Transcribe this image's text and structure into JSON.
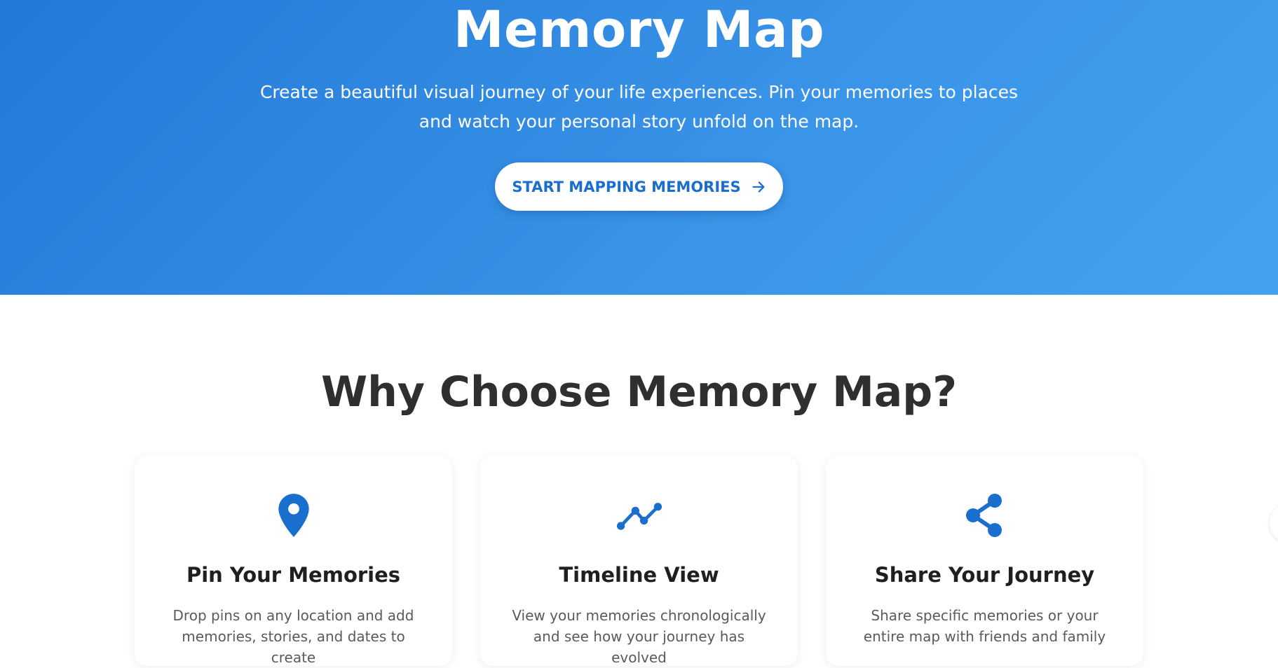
{
  "hero": {
    "title": "Memory Map",
    "subtitle": "Create a beautiful visual journey of your life experiences. Pin your memories to places and watch your personal story unfold on the map.",
    "cta_label": "START MAPPING MEMORIES"
  },
  "features": {
    "title": "Why Choose Memory Map?",
    "cards": [
      {
        "icon": "map-pin-icon",
        "title": "Pin Your Memories",
        "description": "Drop pins on any location and add memories, stories, and dates to create"
      },
      {
        "icon": "timeline-icon",
        "title": "Timeline View",
        "description": "View your memories chronologically and see how your journey has evolved"
      },
      {
        "icon": "share-icon",
        "title": "Share Your Journey",
        "description": "Share specific memories or your entire map with friends and family"
      }
    ]
  },
  "colors": {
    "hero_start": "#2379d8",
    "hero_end": "#43a2ef",
    "accent": "#1a6fce",
    "heading": "#2f2f2f",
    "body_text": "#5a5a5a"
  }
}
